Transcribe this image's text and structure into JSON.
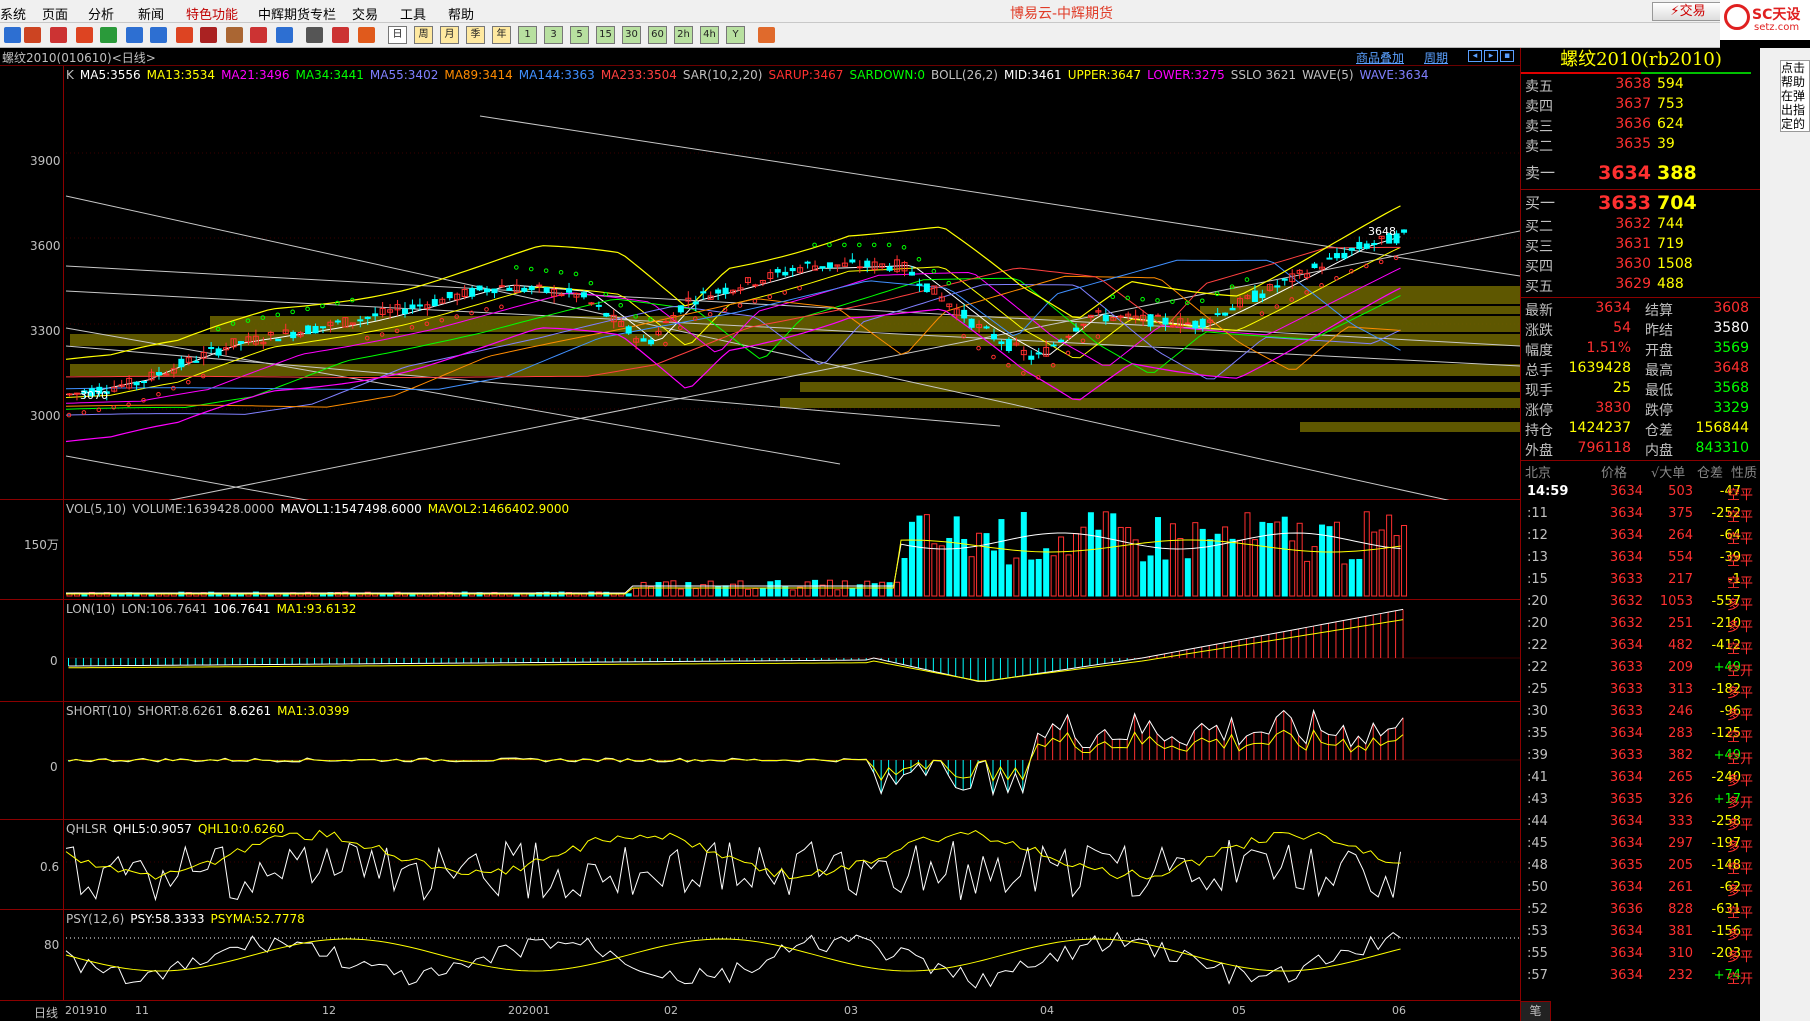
{
  "menubar": {
    "items": [
      "系统",
      "页面",
      "分析",
      "新闻",
      "特色功能",
      "中辉期货专栏",
      "交易",
      "工具",
      "帮助"
    ],
    "app_title": "博易云-中辉期货",
    "trade_button": "交易",
    "logo_text": "SC天设",
    "logo_sub": "setz.com"
  },
  "toolbar": {
    "period_buttons": [
      "日",
      "周",
      "月",
      "季",
      "年",
      "1",
      "3",
      "5",
      "15",
      "30",
      "60",
      "2h",
      "4h",
      "Y"
    ]
  },
  "chart_header": {
    "title": "螺纹2010(010610)<日线>",
    "link1": "商品叠加",
    "link2": "周期"
  },
  "main_panel": {
    "legend": [
      {
        "text": "K",
        "color": "#c0c0c0"
      },
      {
        "text": "MA5:3556",
        "color": "#ffffff"
      },
      {
        "text": "MA13:3534",
        "color": "#ffff00"
      },
      {
        "text": "MA21:3496",
        "color": "#ff00ff"
      },
      {
        "text": "MA34:3441",
        "color": "#00ff00"
      },
      {
        "text": "MA55:3402",
        "color": "#8080ff"
      },
      {
        "text": "MA89:3414",
        "color": "#ff8c00"
      },
      {
        "text": "MA144:3363",
        "color": "#4090ff"
      },
      {
        "text": "MA233:3504",
        "color": "#ff4040"
      },
      {
        "text": "SAR(10,2,20)",
        "color": "#c0c0c0"
      },
      {
        "text": "SARUP:3467",
        "color": "#ff3030"
      },
      {
        "text": "SARDOWN:0",
        "color": "#00ff00"
      },
      {
        "text": "BOLL(26,2)",
        "color": "#c0c0c0"
      },
      {
        "text": "MID:3461",
        "color": "#ffffff"
      },
      {
        "text": "UPPER:3647",
        "color": "#ffff00"
      },
      {
        "text": "LOWER:3275",
        "color": "#ff00ff"
      },
      {
        "text": "SSLO 3621",
        "color": "#c0c0c0"
      },
      {
        "text": "WAVE(5)",
        "color": "#c0c0c0"
      },
      {
        "text": "WAVE:3634",
        "color": "#8080ff"
      }
    ],
    "y_ticks": [
      "3900",
      "3600",
      "3300",
      "3000"
    ],
    "annot_high": "3648",
    "annot_low": "3070"
  },
  "vol_panel": {
    "legend": [
      {
        "text": "VOL(5,10)",
        "color": "#c0c0c0"
      },
      {
        "text": "VOLUME:1639428.0000",
        "color": "#c0c0c0"
      },
      {
        "text": "MAVOL1:1547498.6000",
        "color": "#ffffff"
      },
      {
        "text": "MAVOL2:1466402.9000",
        "color": "#ffff00"
      }
    ],
    "y_tick": "150万"
  },
  "lon_panel": {
    "legend": [
      {
        "text": "LON(10)",
        "color": "#c0c0c0"
      },
      {
        "text": "LON:106.7641",
        "color": "#c0c0c0"
      },
      {
        "text": "106.7641",
        "color": "#ffffff"
      },
      {
        "text": "MA1:93.6132",
        "color": "#ffff00"
      }
    ],
    "y_tick": "0"
  },
  "short_panel": {
    "legend": [
      {
        "text": "SHORT(10)",
        "color": "#c0c0c0"
      },
      {
        "text": "SHORT:8.6261",
        "color": "#c0c0c0"
      },
      {
        "text": "8.6261",
        "color": "#ffffff"
      },
      {
        "text": "MA1:3.0399",
        "color": "#ffff00"
      }
    ],
    "y_tick": "0"
  },
  "qhl_panel": {
    "legend": [
      {
        "text": "QHLSR",
        "color": "#c0c0c0"
      },
      {
        "text": "QHL5:0.9057",
        "color": "#ffffff"
      },
      {
        "text": "QHL10:0.6260",
        "color": "#ffff00"
      }
    ],
    "y_tick": "0.6"
  },
  "psy_panel": {
    "legend": [
      {
        "text": "PSY(12,6)",
        "color": "#c0c0c0"
      },
      {
        "text": "PSY:58.3333",
        "color": "#ffffff"
      },
      {
        "text": "PSYMA:52.7778",
        "color": "#ffff00"
      }
    ],
    "y_tick": "80"
  },
  "x_axis": {
    "period_label": "日线",
    "labels": [
      "201910",
      "11",
      "12",
      "202001",
      "02",
      "03",
      "04",
      "05",
      "06"
    ]
  },
  "quote": {
    "title": "螺纹2010(rb2010)",
    "asks": [
      {
        "label": "卖五",
        "price": "3638",
        "vol": "594"
      },
      {
        "label": "卖四",
        "price": "3637",
        "vol": "753"
      },
      {
        "label": "卖三",
        "price": "3636",
        "vol": "624"
      },
      {
        "label": "卖二",
        "price": "3635",
        "vol": "39"
      },
      {
        "label": "卖一",
        "price": "3634",
        "vol": "388"
      }
    ],
    "bids": [
      {
        "label": "买一",
        "price": "3633",
        "vol": "704"
      },
      {
        "label": "买二",
        "price": "3632",
        "vol": "744"
      },
      {
        "label": "买三",
        "price": "3631",
        "vol": "719"
      },
      {
        "label": "买四",
        "price": "3630",
        "vol": "1508"
      },
      {
        "label": "买五",
        "price": "3629",
        "vol": "488"
      }
    ],
    "stats": [
      {
        "l1": "最新",
        "v1": "3634",
        "c1": "#ff3030",
        "l2": "结算",
        "v2": "3608",
        "c2": "#ff3030"
      },
      {
        "l1": "涨跌",
        "v1": "54",
        "c1": "#ff3030",
        "l2": "昨结",
        "v2": "3580",
        "c2": "#ffffff"
      },
      {
        "l1": "幅度",
        "v1": "1.51%",
        "c1": "#ff3030",
        "l2": "开盘",
        "v2": "3569",
        "c2": "#00ff00"
      },
      {
        "l1": "总手",
        "v1": "1639428",
        "c1": "#ffff00",
        "l2": "最高",
        "v2": "3648",
        "c2": "#ff3030"
      },
      {
        "l1": "现手",
        "v1": "25",
        "c1": "#ffff00",
        "l2": "最低",
        "v2": "3568",
        "c2": "#00ff00"
      },
      {
        "l1": "涨停",
        "v1": "3830",
        "c1": "#ff3030",
        "l2": "跌停",
        "v2": "3329",
        "c2": "#00ff00"
      },
      {
        "l1": "持仓",
        "v1": "1424237",
        "c1": "#ffff00",
        "l2": "仓差",
        "v2": "156844",
        "c2": "#ffff00"
      },
      {
        "l1": "外盘",
        "v1": "796118",
        "c1": "#ff3030",
        "l2": "内盘",
        "v2": "843310",
        "c2": "#00ff00"
      }
    ],
    "tick_header": [
      "北京",
      "价格",
      "√大单",
      "仓差",
      "性质"
    ],
    "ticks": [
      {
        "t": "14:59",
        "p": "3634",
        "v": "503",
        "oi": "-47",
        "n": "空平"
      },
      {
        "t": ":11",
        "p": "3634",
        "v": "375",
        "oi": "-252",
        "n": "空平"
      },
      {
        "t": ":12",
        "p": "3634",
        "v": "264",
        "oi": "-64",
        "n": "空平"
      },
      {
        "t": ":13",
        "p": "3634",
        "v": "554",
        "oi": "-39",
        "n": "空平"
      },
      {
        "t": ":15",
        "p": "3633",
        "v": "217",
        "oi": "-1",
        "n": "空平"
      },
      {
        "t": ":20",
        "p": "3632",
        "v": "1053",
        "oi": "-557",
        "n": "多平"
      },
      {
        "t": ":20",
        "p": "3632",
        "v": "251",
        "oi": "-210",
        "n": "多平"
      },
      {
        "t": ":22",
        "p": "3634",
        "v": "482",
        "oi": "-412",
        "n": "空平"
      },
      {
        "t": ":22",
        "p": "3633",
        "v": "209",
        "oi": "+49",
        "n": "空开"
      },
      {
        "t": ":25",
        "p": "3633",
        "v": "313",
        "oi": "-182",
        "n": "多平"
      },
      {
        "t": ":30",
        "p": "3633",
        "v": "246",
        "oi": "-96",
        "n": "多平"
      },
      {
        "t": ":35",
        "p": "3634",
        "v": "283",
        "oi": "-125",
        "n": "空平"
      },
      {
        "t": ":39",
        "p": "3633",
        "v": "382",
        "oi": "+49",
        "n": "空开"
      },
      {
        "t": ":41",
        "p": "3634",
        "v": "265",
        "oi": "-240",
        "n": "多平"
      },
      {
        "t": ":43",
        "p": "3635",
        "v": "326",
        "oi": "+17",
        "n": "多开"
      },
      {
        "t": ":44",
        "p": "3634",
        "v": "333",
        "oi": "-258",
        "n": "多平"
      },
      {
        "t": ":45",
        "p": "3634",
        "v": "297",
        "oi": "-197",
        "n": "多平"
      },
      {
        "t": ":48",
        "p": "3635",
        "v": "205",
        "oi": "-148",
        "n": "空平"
      },
      {
        "t": ":50",
        "p": "3634",
        "v": "261",
        "oi": "-62",
        "n": "多平"
      },
      {
        "t": ":52",
        "p": "3636",
        "v": "828",
        "oi": "-631",
        "n": "空平"
      },
      {
        "t": ":53",
        "p": "3634",
        "v": "381",
        "oi": "-156",
        "n": "多平"
      },
      {
        "t": ":55",
        "p": "3634",
        "v": "310",
        "oi": "-203",
        "n": "多平"
      },
      {
        "t": ":57",
        "p": "3634",
        "v": "232",
        "oi": "+74",
        "n": "空开"
      }
    ],
    "bottom_tab": "笔"
  },
  "side_note": "点击帮助在弹出指定的"
}
